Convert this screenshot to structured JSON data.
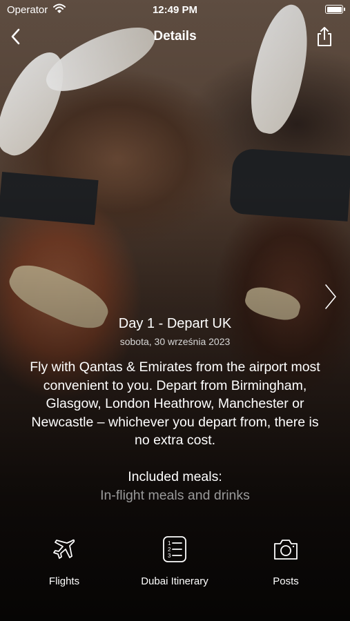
{
  "status_bar": {
    "carrier": "Operator",
    "time": "12:49 PM"
  },
  "nav": {
    "title": "Details"
  },
  "day": {
    "title": "Day 1 - Depart UK",
    "date": "sobota, 30 września 2023",
    "description": "Fly with Qantas & Emirates from the airport most convenient to you. Depart from Birmingham, Glasgow, London Heathrow, Manchester or Newcastle – whichever you depart from, there is no extra cost.",
    "meals_label": "Included meals:",
    "meals_value": "In-flight meals and drinks"
  },
  "tabs": [
    {
      "label": "Flights",
      "icon": "airplane-icon"
    },
    {
      "label": "Dubai Itinerary",
      "icon": "numbered-list-icon"
    },
    {
      "label": "Posts",
      "icon": "camera-icon"
    }
  ]
}
